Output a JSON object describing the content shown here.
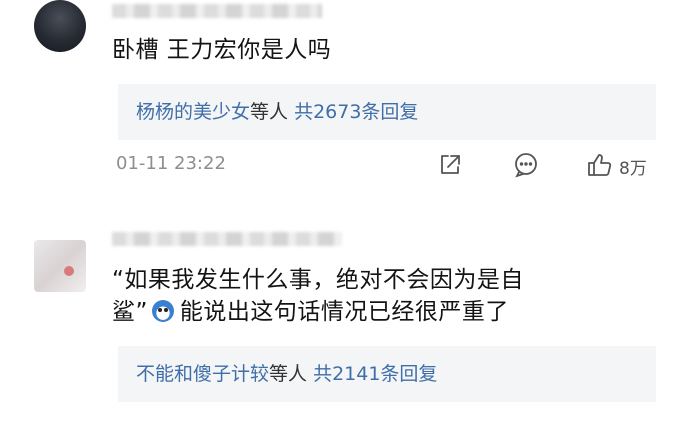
{
  "comments": [
    {
      "username": "",
      "text": "卧槽 王力宏你是人吗",
      "replies": {
        "names": "杨杨的美少女",
        "mid": "等人",
        "count": "共2673条回复"
      },
      "time": "01-11 23:22",
      "likes": "8万",
      "icons": [
        "share-icon",
        "comment-icon",
        "thumbs-up-icon"
      ]
    },
    {
      "username": "",
      "text_line1": "“如果我发生什么事，绝对不会因为是自",
      "text_line2_a": "鲨”",
      "text_line2_b": "能说出这句话情况已经很严重了",
      "emoji": "doraemon-emoji",
      "replies": {
        "names": "不能和傻子计较",
        "mid": "等人",
        "count": "共2141条回复"
      }
    }
  ],
  "colors": {
    "link": "#3f6ea8",
    "reply_bg": "#f4f5f7",
    "meta": "#8e8e8e"
  }
}
